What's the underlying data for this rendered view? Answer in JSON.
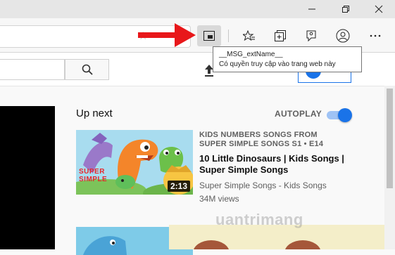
{
  "window": {
    "controls": [
      "minimize-icon",
      "restore-icon",
      "close-icon"
    ]
  },
  "toolbar": {
    "icons": [
      "star-outline-icon",
      "picture-in-picture-icon",
      "favorites-icon",
      "collections-icon",
      "feedback-icon",
      "profile-icon",
      "more-icon"
    ]
  },
  "tooltip": {
    "line1": "__MSG_extName__",
    "line2": "Có quyền truy cập vào trang web này"
  },
  "page": {
    "upnext": "Up next",
    "autoplay": "AUTOPLAY",
    "autoplay_on": true
  },
  "video": {
    "category": "KIDS NUMBERS SONGS FROM SUPER SIMPLE SONGS  S1 • E14",
    "title": "10 Little Dinosaurs | Kids Songs | Super Simple Songs",
    "channel": "Super Simple Songs - Kids Songs",
    "views": "34M views",
    "duration": "2:13",
    "thumb_text": "SUPER SIMPLE"
  },
  "watermark": "uantrimang",
  "colors": {
    "accent": "#1a73e8",
    "arrow": "#e8171a"
  }
}
